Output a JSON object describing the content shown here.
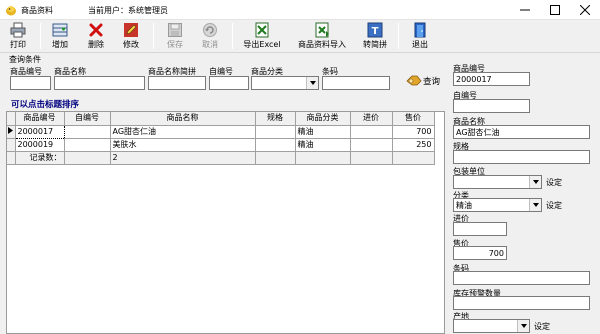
{
  "window": {
    "title": "商品资料",
    "current_user": "当前用户：系统管理员"
  },
  "toolbar": {
    "print": "打印",
    "add": "增加",
    "delete": "删除",
    "edit": "修改",
    "save": "保存",
    "cancel": "取消",
    "export_excel": "导出Excel",
    "import": "商品资料导入",
    "pinyin": "转简拼",
    "exit": "退出"
  },
  "query": {
    "legend": "查询条件",
    "labels": [
      "商品编号",
      "商品名称",
      "商品名称简拼",
      "自编号",
      "商品分类",
      "条码"
    ],
    "button": "查询"
  },
  "hint": "可以点击标题排序",
  "grid": {
    "columns": [
      "商品编号",
      "自编号",
      "商品名称",
      "规格",
      "商品分类",
      "进价",
      "售价"
    ],
    "rows": [
      [
        "2000017",
        "",
        "AG甜杏仁油",
        "",
        "精油",
        "",
        "700"
      ],
      [
        "2000019",
        "",
        "美肤水",
        "",
        "精油",
        "",
        "250"
      ]
    ],
    "total_label": "记录数：",
    "total_value": "2"
  },
  "detail": {
    "code_label": "商品编号",
    "code_value": "2000017",
    "self_code_label": "自编号",
    "name_label": "商品名称",
    "name_value": "AG甜杏仁油",
    "spec_label": "规格",
    "unit_label": "包装单位",
    "set_label": "设定",
    "category_label": "分类",
    "category_value": "精油",
    "cost_label": "进价",
    "price_label": "售价",
    "price_value": "700",
    "barcode_label": "条码",
    "stock_warning_label": "库存预警数量",
    "origin_label": "产地"
  }
}
